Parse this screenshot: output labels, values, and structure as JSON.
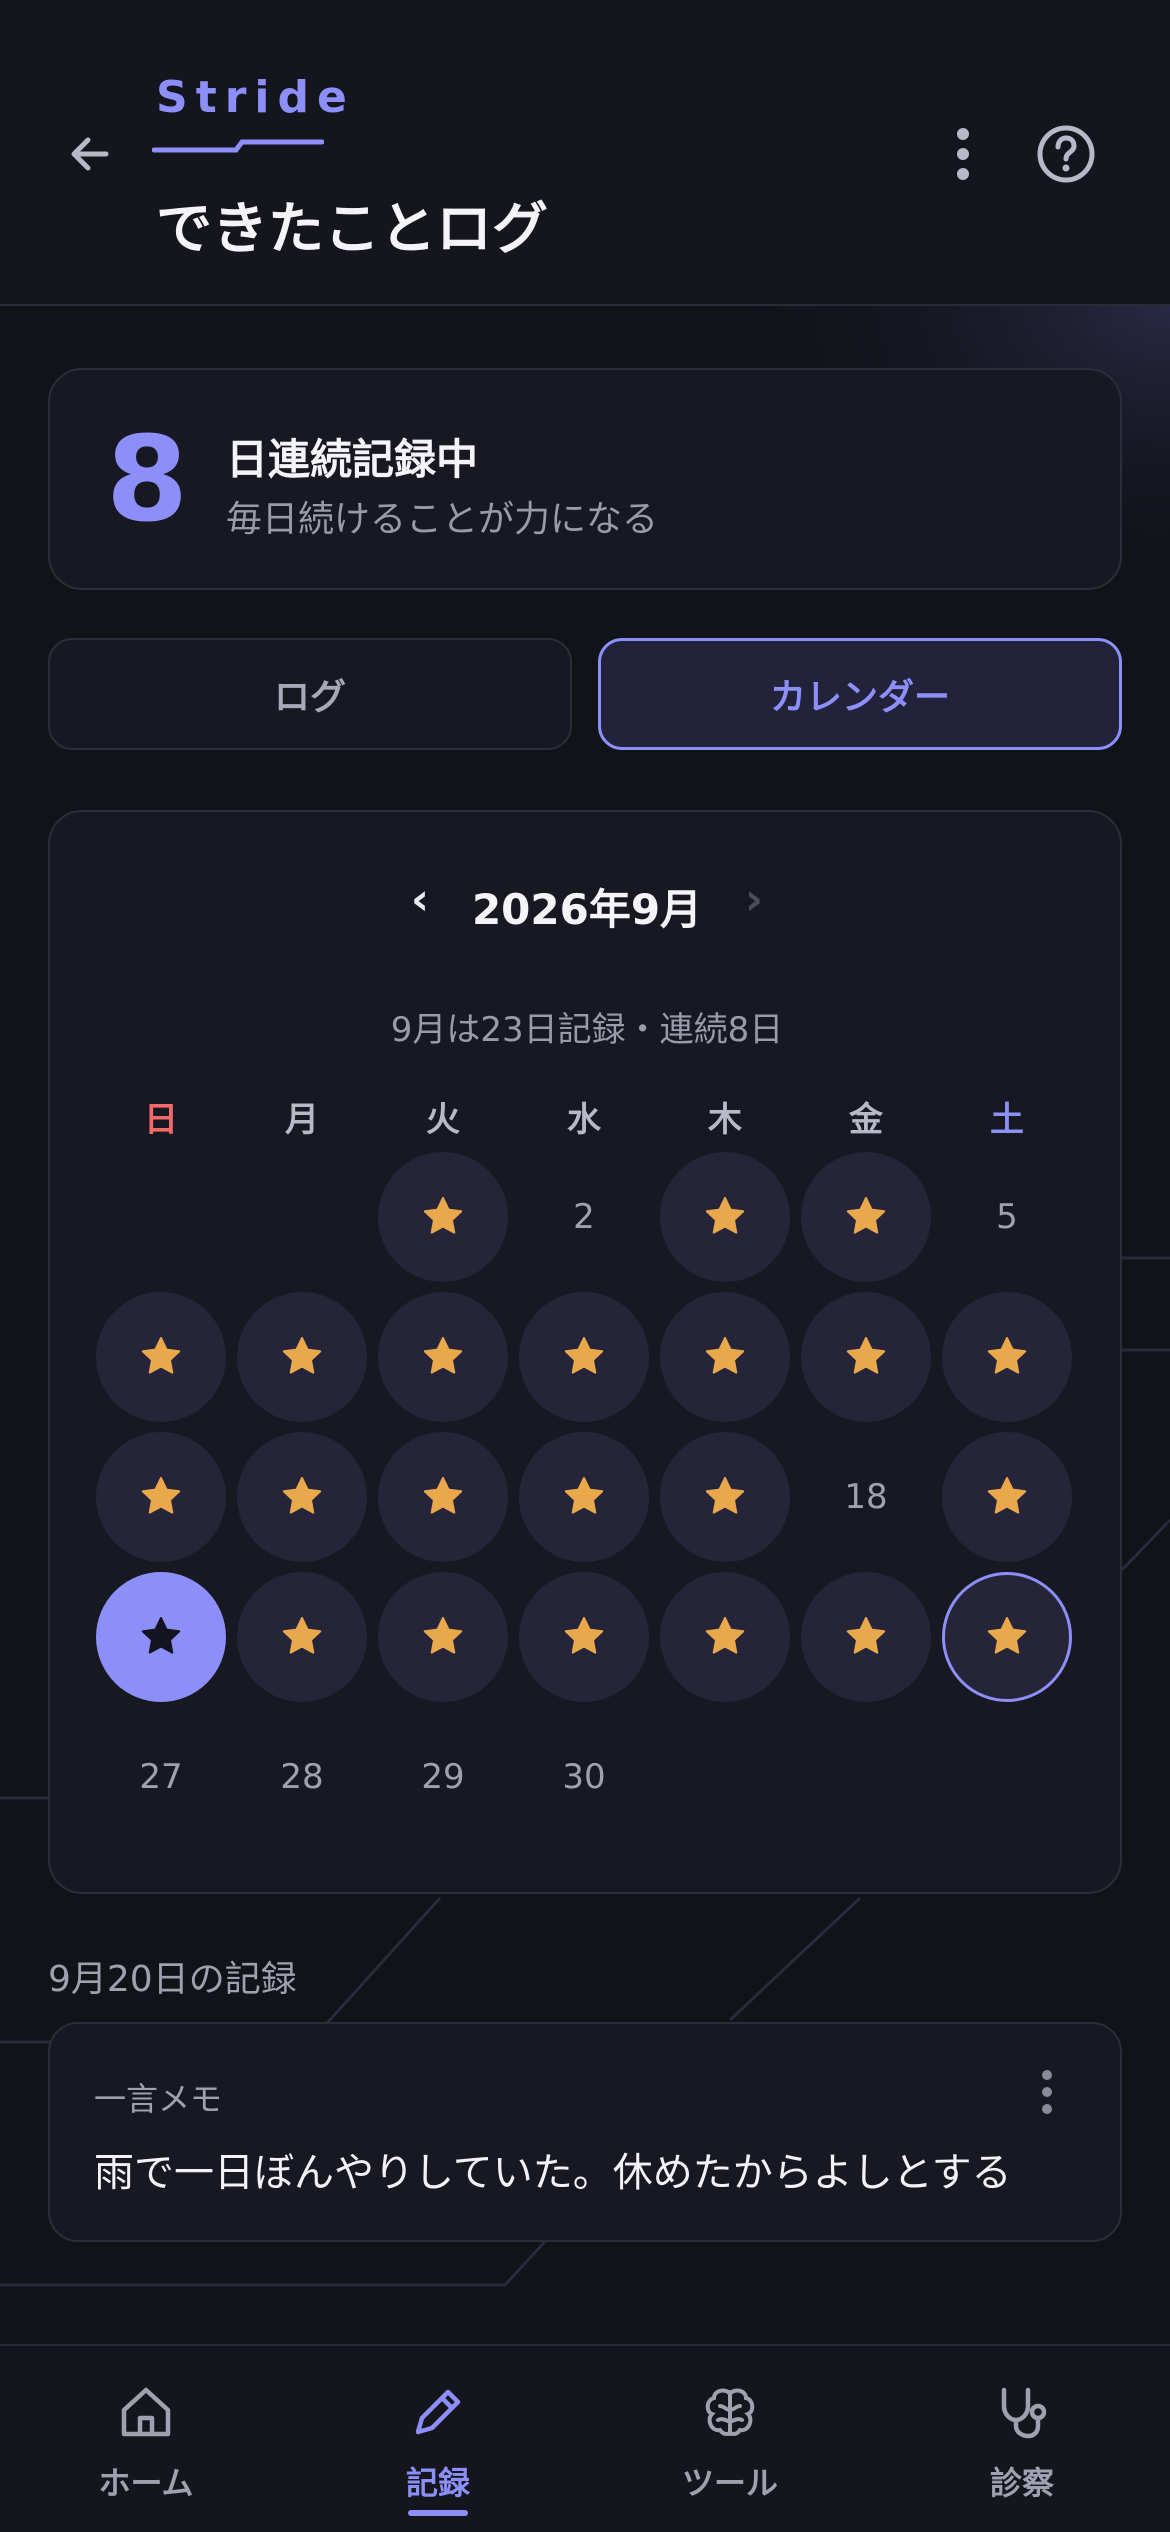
{
  "header": {
    "brand": "Stride",
    "title": "できたことログ",
    "icons": {
      "back": "back-arrow-icon",
      "more": "more-vertical-icon",
      "help": "help-circle-icon"
    }
  },
  "streak": {
    "count": "8",
    "title": "日連続記録中",
    "subtitle": "毎日続けることが力になる"
  },
  "tabs": [
    {
      "label": "ログ",
      "active": false
    },
    {
      "label": "カレンダー",
      "active": true
    }
  ],
  "calendar": {
    "prev": "‹",
    "month_label": "2026年9月",
    "next": "›",
    "summary": "9月は23日記録・連続8日",
    "weekdays": [
      "日",
      "月",
      "火",
      "水",
      "木",
      "金",
      "土"
    ],
    "days": [
      {
        "day": "1",
        "done": true
      },
      {
        "day": "2",
        "done": false
      },
      {
        "day": "3",
        "done": true
      },
      {
        "day": "4",
        "done": true
      },
      {
        "day": "5",
        "done": false
      },
      {
        "day": "6",
        "done": true
      },
      {
        "day": "7",
        "done": true
      },
      {
        "day": "8",
        "done": true
      },
      {
        "day": "9",
        "done": true
      },
      {
        "day": "10",
        "done": true
      },
      {
        "day": "11",
        "done": true
      },
      {
        "day": "12",
        "done": true
      },
      {
        "day": "13",
        "done": true
      },
      {
        "day": "14",
        "done": true
      },
      {
        "day": "15",
        "done": true
      },
      {
        "day": "16",
        "done": true
      },
      {
        "day": "17",
        "done": true
      },
      {
        "day": "18",
        "done": false
      },
      {
        "day": "19",
        "done": true
      },
      {
        "day": "20",
        "done": true,
        "selected": true
      },
      {
        "day": "21",
        "done": true
      },
      {
        "day": "22",
        "done": true
      },
      {
        "day": "23",
        "done": true
      },
      {
        "day": "24",
        "done": true
      },
      {
        "day": "25",
        "done": true
      },
      {
        "day": "26",
        "done": true,
        "today": true
      },
      {
        "day": "27",
        "done": false
      },
      {
        "day": "28",
        "done": false
      },
      {
        "day": "29",
        "done": false
      },
      {
        "day": "30",
        "done": false
      }
    ],
    "first_weekday_index": 2
  },
  "record": {
    "label": "9月20日の記録",
    "memo_title": "一言メモ",
    "memo_text": "雨で一日ぼんやりしていた。休めたからよしとする"
  },
  "nav": [
    {
      "label": "ホーム",
      "icon": "home-icon",
      "active": false
    },
    {
      "label": "記録",
      "icon": "pencil-icon",
      "active": true
    },
    {
      "label": "ツール",
      "icon": "brain-icon",
      "active": false
    },
    {
      "label": "診察",
      "icon": "stethoscope-icon",
      "active": false
    }
  ],
  "colors": {
    "accent": "#8b8ff7",
    "star": "#e9a84c",
    "sunday": "#f06a6a",
    "background": "#121219"
  }
}
